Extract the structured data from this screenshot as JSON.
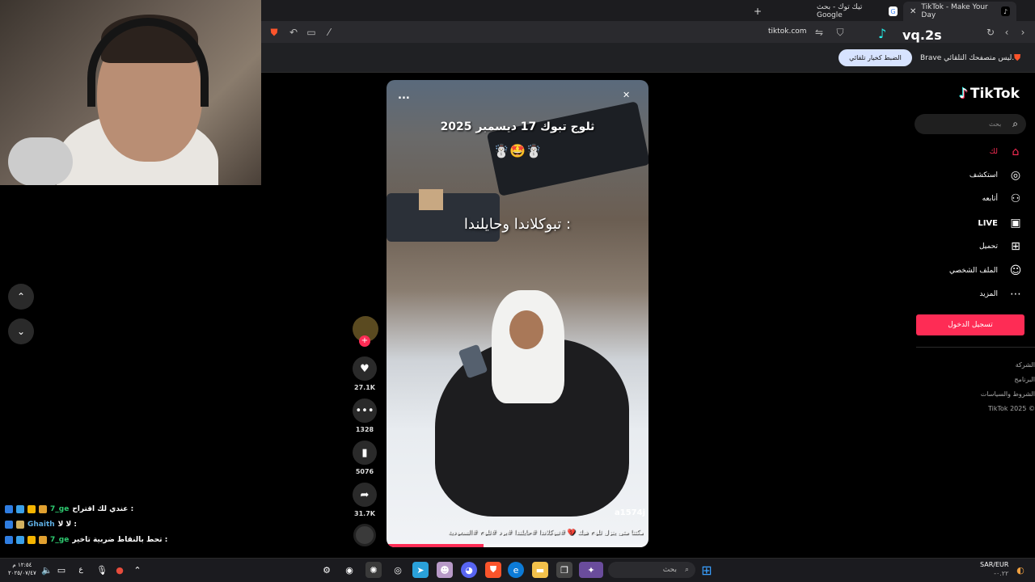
{
  "browser": {
    "tabs": [
      {
        "label": "TikTok - Make Your Day",
        "active": true
      },
      {
        "label": "تيك توك - بحث Google",
        "active": false
      }
    ],
    "new_tab_icon": "plus-icon",
    "url": "tiktok.com",
    "infobar_message": "Brave ليس متصفحك التلقائي.",
    "infobar_button": "الضبط كخيار تلقائي"
  },
  "watermark": "vq.2s",
  "tiktok": {
    "logo": "TikTok",
    "search_placeholder": "بحث",
    "nav": [
      {
        "label": "لك",
        "icon": "home-icon"
      },
      {
        "label": "استكشف",
        "icon": "compass-icon"
      },
      {
        "label": "أتابعه",
        "icon": "user-plus-icon"
      },
      {
        "label": "LIVE",
        "icon": "live-icon"
      },
      {
        "label": "تحميل",
        "icon": "upload-icon"
      },
      {
        "label": "الملف الشخصي",
        "icon": "profile-icon"
      },
      {
        "label": "المزيد",
        "icon": "more-icon"
      }
    ],
    "login_button": "تسجيل الدخول",
    "footer_links": [
      "الشركة",
      "البرنامج",
      "الشروط والسياسات",
      "TikTok 2025 ©"
    ]
  },
  "video": {
    "title_line1": "ثلوج تبوك 17 ديسمبر 2025",
    "title_emoji": "☃️🤩☃️",
    "overlay_text": "تبوكلاندا وحايلندا :",
    "watermark": "a1574j",
    "caption": "مكتنا متى ينزل ثلوج هيك 💔 #تبوكلاندا #حايلندا #برد #ثلوج #السعودية",
    "more_label": "...",
    "progress": 0.37
  },
  "actions": {
    "likes": "27.1K",
    "comments": "1328",
    "saves": "5076",
    "shares": "31.7K"
  },
  "chat": [
    {
      "user": "7_ge",
      "message": "عندي لك اقتراح :"
    },
    {
      "user": "Ghaith",
      "message": "لا لا :"
    },
    {
      "user": "7_ge",
      "message": "تحط بالنقاط ضربية تاخير :"
    }
  ],
  "taskbar": {
    "search_placeholder": "بحث",
    "currency": "SAR/EUR",
    "currency_change": "-٠.٢٢",
    "time": "١٢:٥٤ م",
    "date": "٢٠٢٥/٠٧/٤٧",
    "lang": "ع"
  },
  "colors": {
    "accent": "#fe2c55",
    "login_bg": "#fe2c55",
    "infobar_btn": "#d7e3ff"
  }
}
